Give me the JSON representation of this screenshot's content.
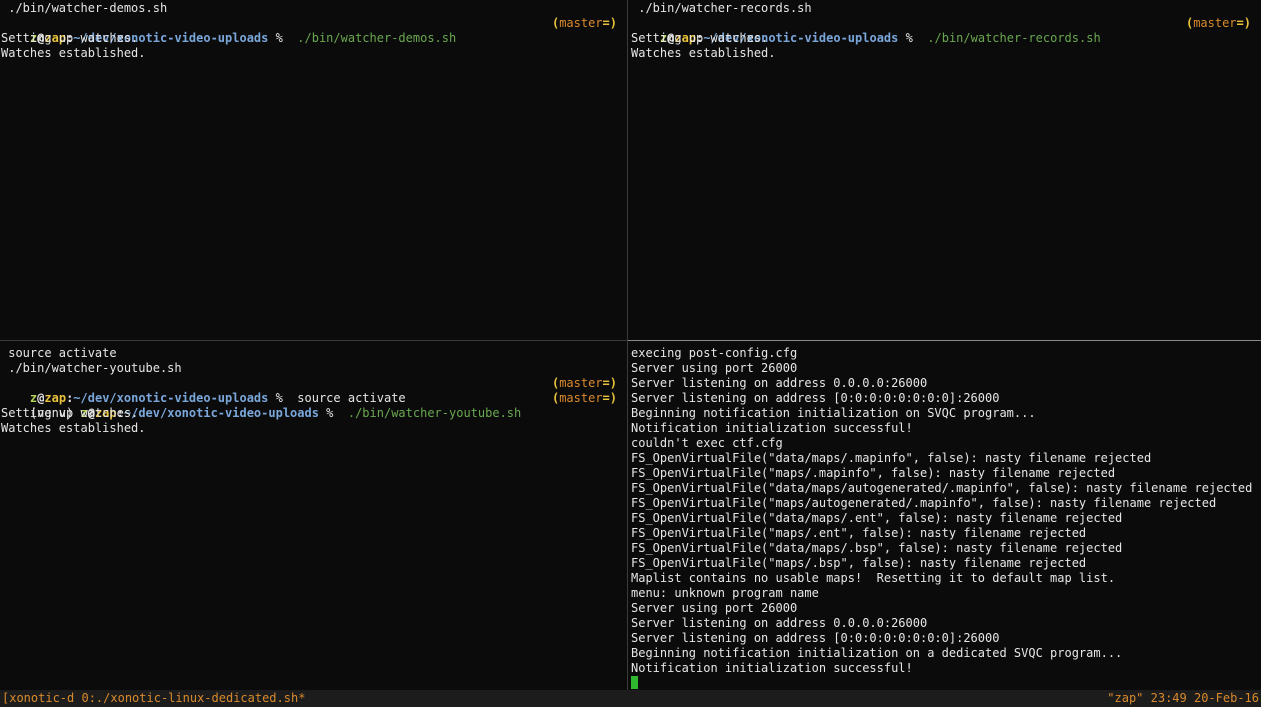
{
  "panes": {
    "top_left": {
      "title_line": " ./bin/watcher-demos.sh",
      "prompt": {
        "user": "z",
        "at": "@",
        "host": "zap",
        "colon": ":",
        "path": "~/dev/xonotic-video-uploads",
        "pct": " %  ",
        "command": "./bin/watcher-demos.sh",
        "branch_open": "(",
        "branch": "master",
        "branch_close": "=)"
      },
      "output": [
        "Setting up watches.",
        "Watches established."
      ]
    },
    "top_right": {
      "title_line": " ./bin/watcher-records.sh",
      "prompt": {
        "user": "z",
        "at": "@",
        "host": "zap",
        "colon": ":",
        "path": "~/dev/xonotic-video-uploads",
        "pct": " %  ",
        "command": "./bin/watcher-records.sh",
        "branch_open": "(",
        "branch": "master",
        "branch_close": "=)"
      },
      "output": [
        "Setting up watches.",
        "Watches established."
      ]
    },
    "bottom_left": {
      "history": [
        " source activate",
        " ./bin/watcher-youtube.sh"
      ],
      "prompt1": {
        "user": "z",
        "at": "@",
        "host": "zap",
        "colon": ":",
        "path": "~/dev/xonotic-video-uploads",
        "pct": " %  ",
        "command": "source activate",
        "branch_open": "(",
        "branch": "master",
        "branch_close": "=)"
      },
      "prompt2": {
        "venv": "(venv) ",
        "user": "z",
        "at": "@",
        "host": "zap",
        "colon": ":",
        "path": "~/dev/xonotic-video-uploads",
        "pct": " %  ",
        "command": "./bin/watcher-youtube.sh",
        "branch_open": "(",
        "branch": "master",
        "branch_close": "=)"
      },
      "output": [
        "Setting up watches.",
        "Watches established."
      ]
    },
    "bottom_right": {
      "output": [
        "execing post-config.cfg",
        "Server using port 26000",
        "Server listening on address 0.0.0.0:26000",
        "Server listening on address [0:0:0:0:0:0:0:0]:26000",
        "Beginning notification initialization on SVQC program...",
        "Notification initialization successful!",
        "couldn't exec ctf.cfg",
        "FS_OpenVirtualFile(\"data/maps/.mapinfo\", false): nasty filename rejected",
        "FS_OpenVirtualFile(\"maps/.mapinfo\", false): nasty filename rejected",
        "FS_OpenVirtualFile(\"data/maps/autogenerated/.mapinfo\", false): nasty filename rejected",
        "FS_OpenVirtualFile(\"maps/autogenerated/.mapinfo\", false): nasty filename rejected",
        "FS_OpenVirtualFile(\"data/maps/.ent\", false): nasty filename rejected",
        "FS_OpenVirtualFile(\"maps/.ent\", false): nasty filename rejected",
        "FS_OpenVirtualFile(\"data/maps/.bsp\", false): nasty filename rejected",
        "FS_OpenVirtualFile(\"maps/.bsp\", false): nasty filename rejected",
        "Maplist contains no usable maps!  Resetting it to default map list.",
        "menu: unknown program name",
        "Server using port 26000",
        "Server listening on address 0.0.0.0:26000",
        "Server listening on address [0:0:0:0:0:0:0:0]:26000",
        "Beginning notification initialization on a dedicated SVQC program...",
        "Notification initialization successful!"
      ]
    }
  },
  "status_bar": {
    "left": "[xonotic-d 0:./xonotic-linux-dedicated.sh*",
    "right": "\"zap\" 23:49 20-Feb-16"
  },
  "colors": {
    "background": "#0b0b0c",
    "prompt_user": "#b5d65a",
    "prompt_host": "#e8c23a",
    "prompt_path": "#7aa6da",
    "command": "#6aa84f",
    "branch": "#d98a2c",
    "cursor": "#2fb82f",
    "status_text": "#d98a2c"
  }
}
